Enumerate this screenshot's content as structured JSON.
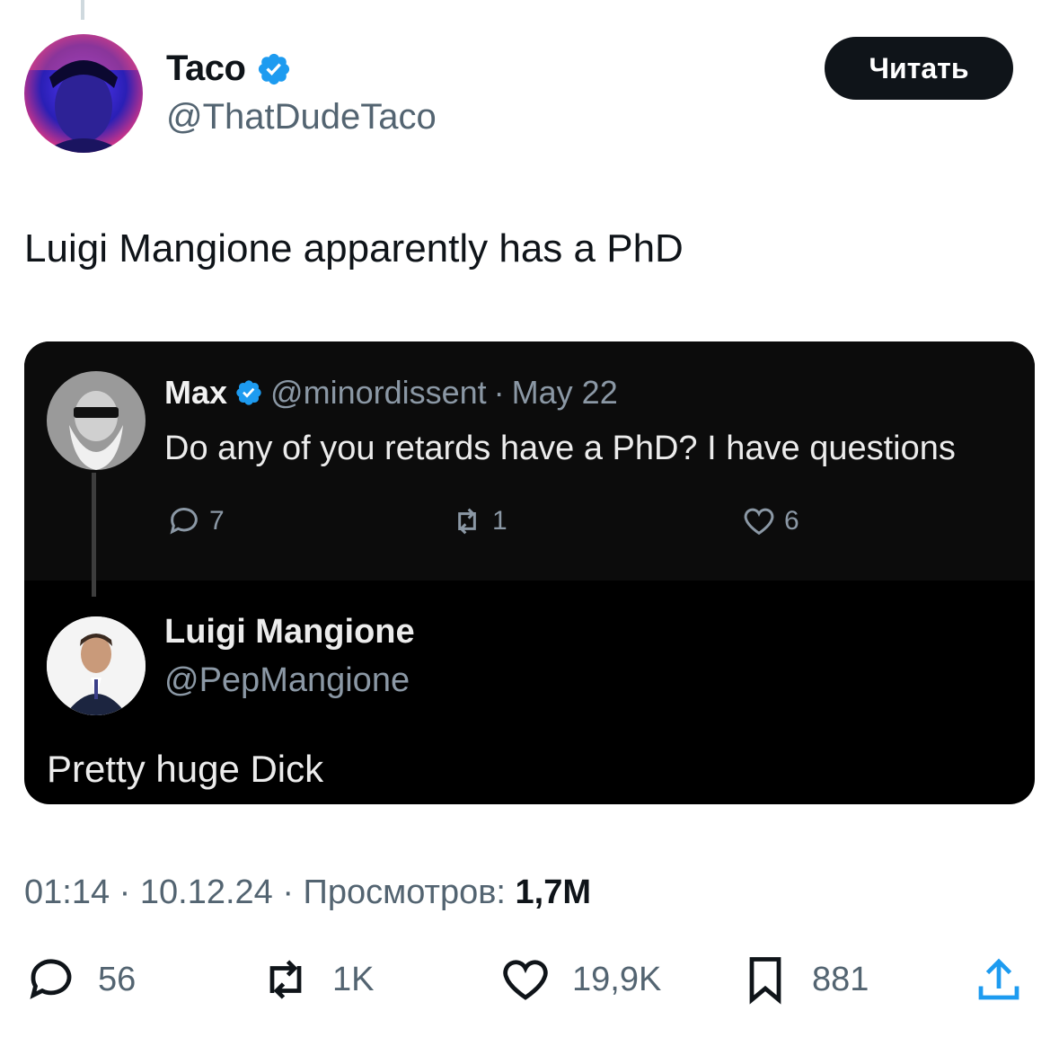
{
  "author": {
    "display_name": "Taco",
    "handle": "@ThatDudeTaco",
    "follow_label": "Читать"
  },
  "tweet": {
    "text": "Luigi Mangione apparently has a PhD"
  },
  "embedded": {
    "quoted": {
      "name": "Max",
      "handle": "@minordissent",
      "separator": "·",
      "date": "May 22",
      "text": "Do any of you retards have a PhD? I have questions",
      "replies": "7",
      "reposts": "1",
      "likes": "6"
    },
    "reply": {
      "name": "Luigi Mangione",
      "handle": "@PepMangione",
      "text": "Pretty huge Dick"
    }
  },
  "meta": {
    "prefix": "01:14 · 10.12.24 · Просмотров: ",
    "views": "1,7M"
  },
  "stats": {
    "replies": "56",
    "reposts": "1K",
    "likes": "19,9K",
    "bookmarks": "881"
  },
  "colors": {
    "verified": "#1d9bf0",
    "button_bg": "#0f1419",
    "secondary_text": "#536471"
  }
}
